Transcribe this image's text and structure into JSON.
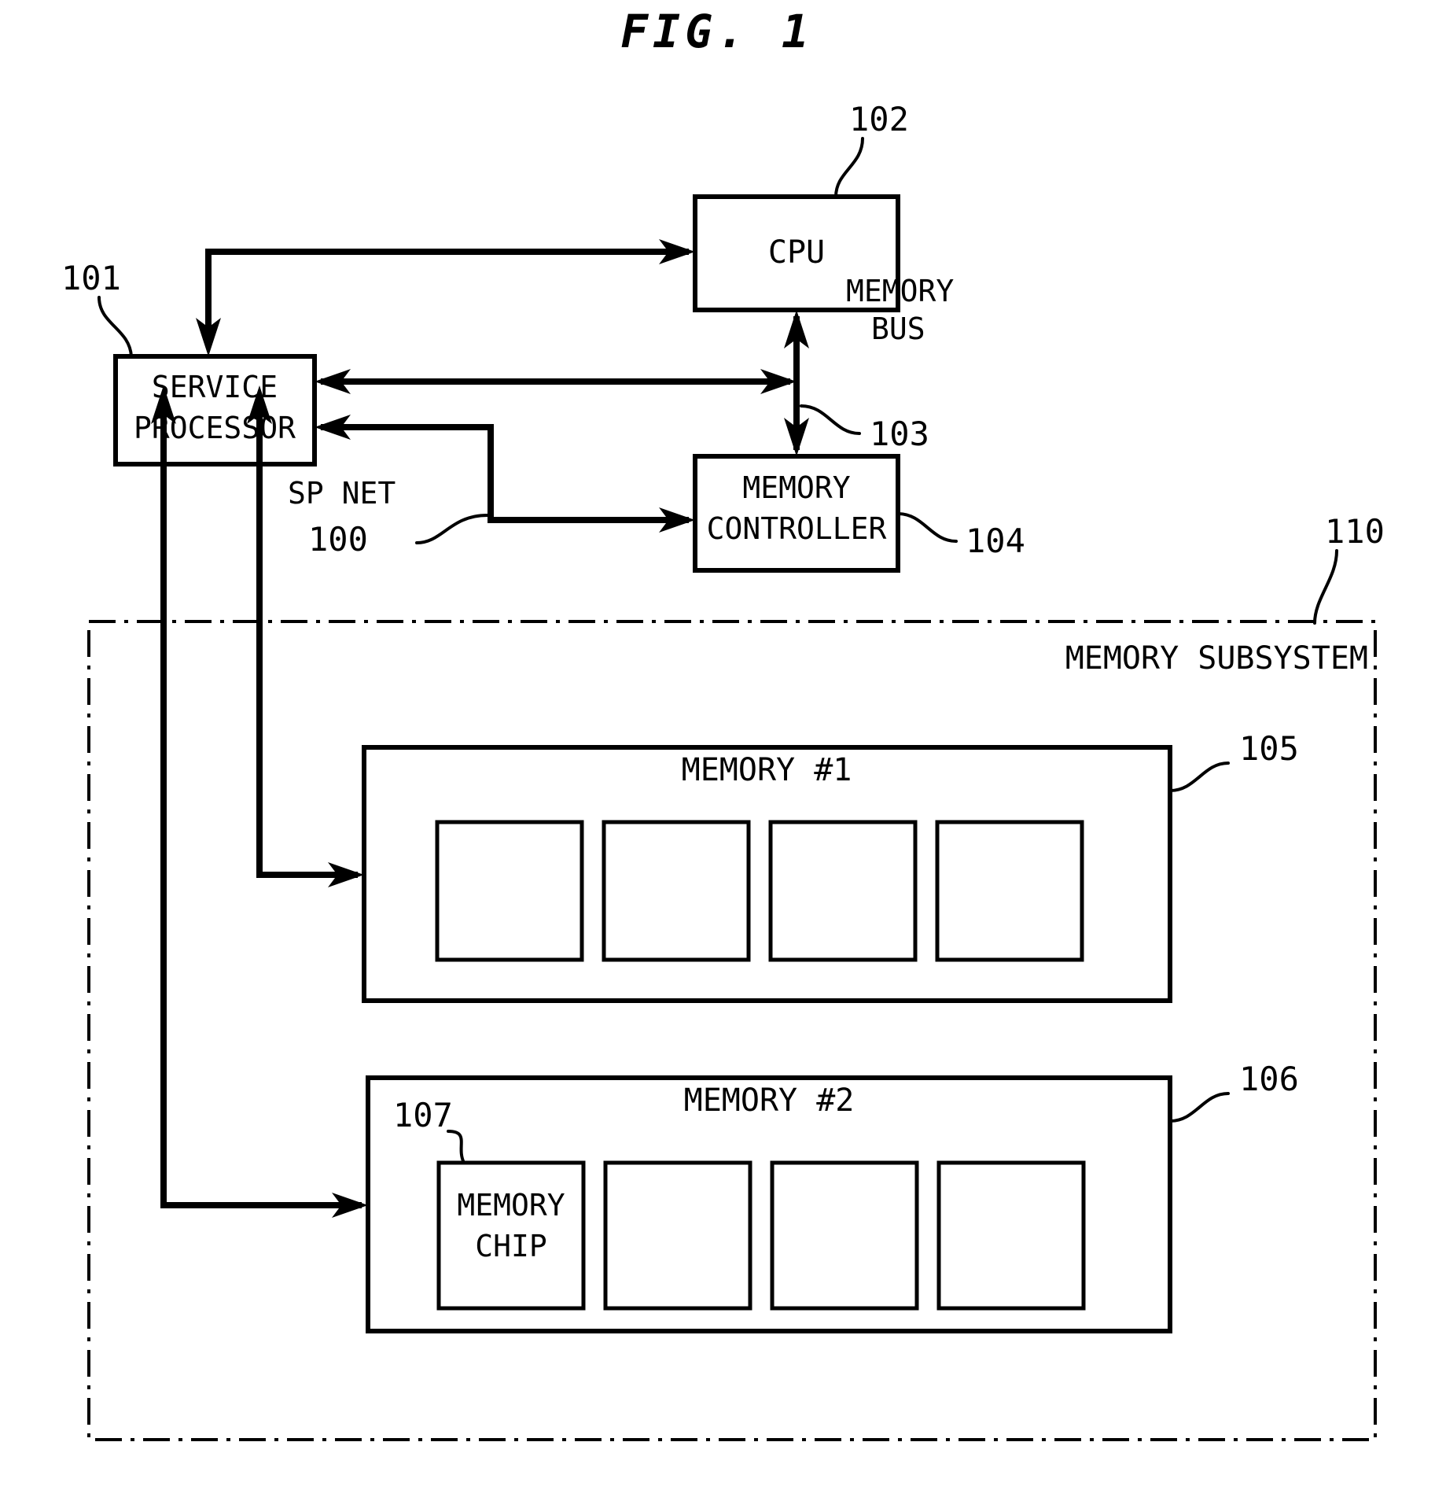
{
  "figure": {
    "title": "FIG. 1"
  },
  "blocks": {
    "cpu": {
      "label": "CPU",
      "ref": "102"
    },
    "service_processor": {
      "label_line1": "SERVICE",
      "label_line2": "PROCESSOR",
      "ref": "101"
    },
    "memory_controller": {
      "label_line1": "MEMORY",
      "label_line2": "CONTROLLER",
      "ref": "104"
    },
    "memory_subsystem": {
      "label": "MEMORY SUBSYSTEM",
      "ref": "110"
    },
    "memory1": {
      "label": "MEMORY #1",
      "ref": "105"
    },
    "memory2": {
      "label": "MEMORY #2",
      "ref": "106"
    },
    "memory_chip": {
      "label_line1": "MEMORY",
      "label_line2": "CHIP",
      "ref": "107"
    }
  },
  "connections": {
    "memory_bus": {
      "label_line1": "MEMORY",
      "label_line2": "BUS",
      "ref": "103"
    },
    "sp_net": {
      "label": "SP NET",
      "ref": "100"
    }
  },
  "chips": {
    "memory1_chips": [
      "",
      "",
      "",
      ""
    ],
    "memory2_chips": [
      "MEMORY CHIP",
      "",
      "",
      ""
    ]
  },
  "colors": {
    "ink": "#000000",
    "paper": "#ffffff"
  }
}
